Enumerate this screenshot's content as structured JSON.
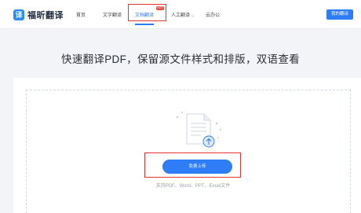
{
  "header": {
    "logo_mark": "译",
    "brand": "福昕翻译",
    "nav": {
      "home": "首页",
      "text_translate": "文字翻译",
      "doc_translate": "文档翻译",
      "doc_badge": "HOT",
      "human_translate": "人工翻译",
      "office": "云办公"
    },
    "my_translate_button": "我的翻译"
  },
  "main": {
    "headline": "快速翻译PDF，保留源文件样式和排版，双语查看",
    "upload_button": "免费上传",
    "support_text": "支持PDF、Word、PPT、Excel文件"
  },
  "colors": {
    "accent": "#2e7cf6",
    "highlight_box": "#e0362f"
  }
}
